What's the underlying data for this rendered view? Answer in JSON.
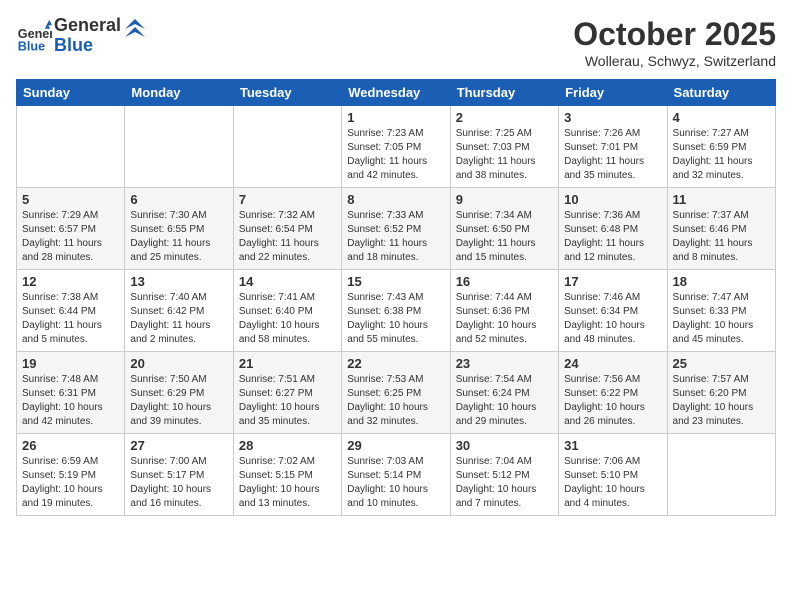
{
  "header": {
    "logo_general": "General",
    "logo_blue": "Blue",
    "month_title": "October 2025",
    "location": "Wollerau, Schwyz, Switzerland"
  },
  "weekdays": [
    "Sunday",
    "Monday",
    "Tuesday",
    "Wednesday",
    "Thursday",
    "Friday",
    "Saturday"
  ],
  "weeks": [
    [
      {
        "day": "",
        "info": ""
      },
      {
        "day": "",
        "info": ""
      },
      {
        "day": "",
        "info": ""
      },
      {
        "day": "1",
        "info": "Sunrise: 7:23 AM\nSunset: 7:05 PM\nDaylight: 11 hours\nand 42 minutes."
      },
      {
        "day": "2",
        "info": "Sunrise: 7:25 AM\nSunset: 7:03 PM\nDaylight: 11 hours\nand 38 minutes."
      },
      {
        "day": "3",
        "info": "Sunrise: 7:26 AM\nSunset: 7:01 PM\nDaylight: 11 hours\nand 35 minutes."
      },
      {
        "day": "4",
        "info": "Sunrise: 7:27 AM\nSunset: 6:59 PM\nDaylight: 11 hours\nand 32 minutes."
      }
    ],
    [
      {
        "day": "5",
        "info": "Sunrise: 7:29 AM\nSunset: 6:57 PM\nDaylight: 11 hours\nand 28 minutes."
      },
      {
        "day": "6",
        "info": "Sunrise: 7:30 AM\nSunset: 6:55 PM\nDaylight: 11 hours\nand 25 minutes."
      },
      {
        "day": "7",
        "info": "Sunrise: 7:32 AM\nSunset: 6:54 PM\nDaylight: 11 hours\nand 22 minutes."
      },
      {
        "day": "8",
        "info": "Sunrise: 7:33 AM\nSunset: 6:52 PM\nDaylight: 11 hours\nand 18 minutes."
      },
      {
        "day": "9",
        "info": "Sunrise: 7:34 AM\nSunset: 6:50 PM\nDaylight: 11 hours\nand 15 minutes."
      },
      {
        "day": "10",
        "info": "Sunrise: 7:36 AM\nSunset: 6:48 PM\nDaylight: 11 hours\nand 12 minutes."
      },
      {
        "day": "11",
        "info": "Sunrise: 7:37 AM\nSunset: 6:46 PM\nDaylight: 11 hours\nand 8 minutes."
      }
    ],
    [
      {
        "day": "12",
        "info": "Sunrise: 7:38 AM\nSunset: 6:44 PM\nDaylight: 11 hours\nand 5 minutes."
      },
      {
        "day": "13",
        "info": "Sunrise: 7:40 AM\nSunset: 6:42 PM\nDaylight: 11 hours\nand 2 minutes."
      },
      {
        "day": "14",
        "info": "Sunrise: 7:41 AM\nSunset: 6:40 PM\nDaylight: 10 hours\nand 58 minutes."
      },
      {
        "day": "15",
        "info": "Sunrise: 7:43 AM\nSunset: 6:38 PM\nDaylight: 10 hours\nand 55 minutes."
      },
      {
        "day": "16",
        "info": "Sunrise: 7:44 AM\nSunset: 6:36 PM\nDaylight: 10 hours\nand 52 minutes."
      },
      {
        "day": "17",
        "info": "Sunrise: 7:46 AM\nSunset: 6:34 PM\nDaylight: 10 hours\nand 48 minutes."
      },
      {
        "day": "18",
        "info": "Sunrise: 7:47 AM\nSunset: 6:33 PM\nDaylight: 10 hours\nand 45 minutes."
      }
    ],
    [
      {
        "day": "19",
        "info": "Sunrise: 7:48 AM\nSunset: 6:31 PM\nDaylight: 10 hours\nand 42 minutes."
      },
      {
        "day": "20",
        "info": "Sunrise: 7:50 AM\nSunset: 6:29 PM\nDaylight: 10 hours\nand 39 minutes."
      },
      {
        "day": "21",
        "info": "Sunrise: 7:51 AM\nSunset: 6:27 PM\nDaylight: 10 hours\nand 35 minutes."
      },
      {
        "day": "22",
        "info": "Sunrise: 7:53 AM\nSunset: 6:25 PM\nDaylight: 10 hours\nand 32 minutes."
      },
      {
        "day": "23",
        "info": "Sunrise: 7:54 AM\nSunset: 6:24 PM\nDaylight: 10 hours\nand 29 minutes."
      },
      {
        "day": "24",
        "info": "Sunrise: 7:56 AM\nSunset: 6:22 PM\nDaylight: 10 hours\nand 26 minutes."
      },
      {
        "day": "25",
        "info": "Sunrise: 7:57 AM\nSunset: 6:20 PM\nDaylight: 10 hours\nand 23 minutes."
      }
    ],
    [
      {
        "day": "26",
        "info": "Sunrise: 6:59 AM\nSunset: 5:19 PM\nDaylight: 10 hours\nand 19 minutes."
      },
      {
        "day": "27",
        "info": "Sunrise: 7:00 AM\nSunset: 5:17 PM\nDaylight: 10 hours\nand 16 minutes."
      },
      {
        "day": "28",
        "info": "Sunrise: 7:02 AM\nSunset: 5:15 PM\nDaylight: 10 hours\nand 13 minutes."
      },
      {
        "day": "29",
        "info": "Sunrise: 7:03 AM\nSunset: 5:14 PM\nDaylight: 10 hours\nand 10 minutes."
      },
      {
        "day": "30",
        "info": "Sunrise: 7:04 AM\nSunset: 5:12 PM\nDaylight: 10 hours\nand 7 minutes."
      },
      {
        "day": "31",
        "info": "Sunrise: 7:06 AM\nSunset: 5:10 PM\nDaylight: 10 hours\nand 4 minutes."
      },
      {
        "day": "",
        "info": ""
      }
    ]
  ]
}
